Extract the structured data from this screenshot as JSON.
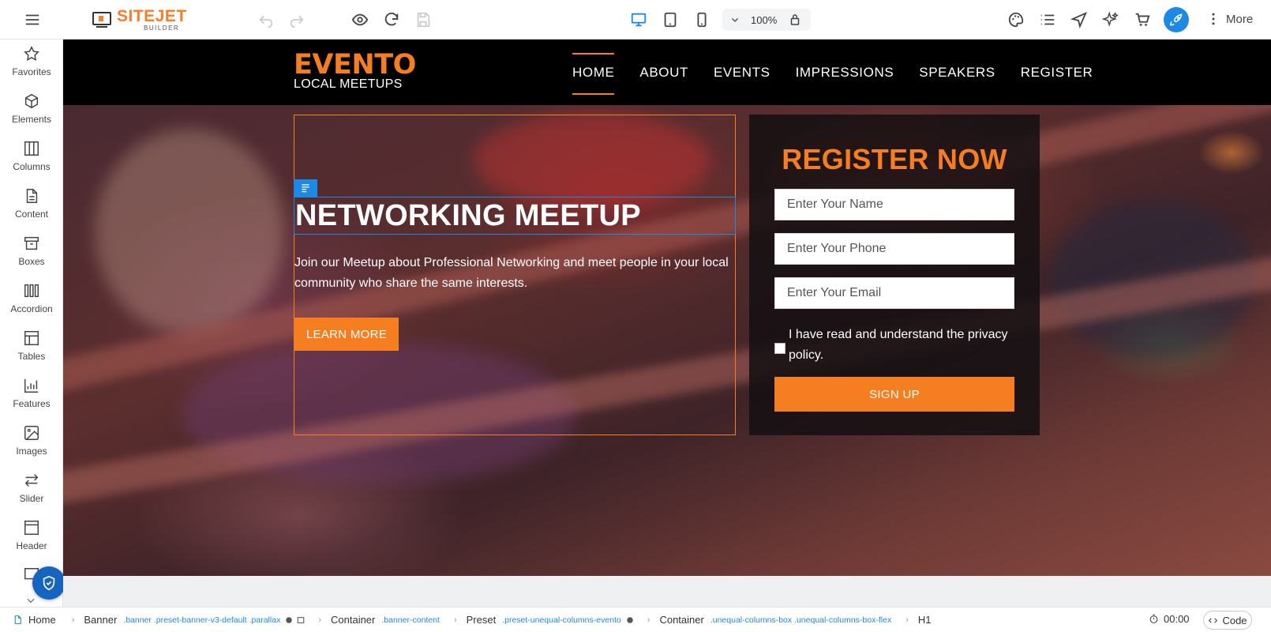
{
  "editor": {
    "logo_main": "SITEJET",
    "logo_sub": "BUILDER",
    "zoom": "100%",
    "more_label": "More",
    "colors": {
      "accent": "#f47e20",
      "brand_blue": "#1e88e5"
    }
  },
  "sidebar": {
    "items": [
      {
        "label": "Favorites",
        "icon": "star-icon"
      },
      {
        "label": "Elements",
        "icon": "cube-icon"
      },
      {
        "label": "Columns",
        "icon": "columns-icon"
      },
      {
        "label": "Content",
        "icon": "document-icon"
      },
      {
        "label": "Boxes",
        "icon": "box-icon"
      },
      {
        "label": "Accordion",
        "icon": "accordion-icon"
      },
      {
        "label": "Tables",
        "icon": "table-icon"
      },
      {
        "label": "Features",
        "icon": "features-icon"
      },
      {
        "label": "Images",
        "icon": "image-icon"
      },
      {
        "label": "Slider",
        "icon": "slider-icon"
      },
      {
        "label": "Header",
        "icon": "header-icon"
      }
    ]
  },
  "site": {
    "brand_main": "EVENTO",
    "brand_sub": "LOCAL MEETUPS",
    "nav": [
      "HOME",
      "ABOUT",
      "EVENTS",
      "IMPRESSIONS",
      "SPEAKERS",
      "REGISTER"
    ],
    "hero_title": "NETWORKING MEETUP",
    "hero_text": "Join our Meetup about Professional Networking and meet people in your local community who share the same interests.",
    "hero_button": "LEARN MORE",
    "register": {
      "title": "REGISTER NOW",
      "name_placeholder": "Enter Your Name",
      "phone_placeholder": "Enter Your Phone",
      "email_placeholder": "Enter Your Email",
      "privacy_text": "I have read and understand the privacy policy.",
      "submit": "SIGN UP"
    }
  },
  "breadcrumb": {
    "home": "Home",
    "items": [
      {
        "name": "Banner",
        "classes": ".banner .preset-banner-v3-default .parallax"
      },
      {
        "name": "Container",
        "classes": ".banner-content"
      },
      {
        "name": "Preset",
        "classes": ".preset-unequal-columns-evento"
      },
      {
        "name": "Container",
        "classes": ".unequal-columns-box .unequal-columns-box-flex"
      },
      {
        "name": "H1",
        "classes": ""
      }
    ],
    "timer": "00:00",
    "code_label": "Code"
  }
}
